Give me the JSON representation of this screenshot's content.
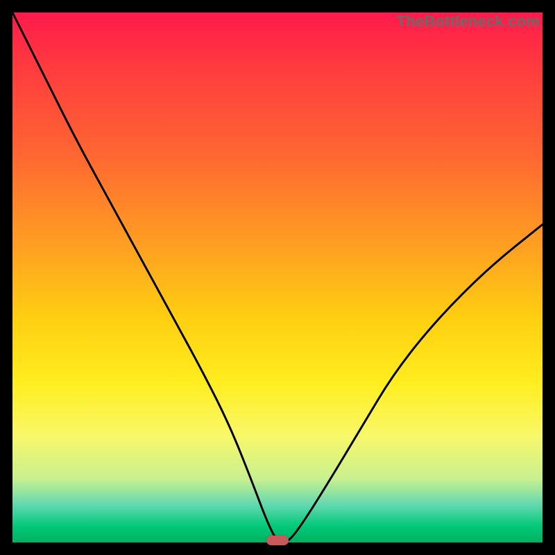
{
  "watermark": "TheBottleneck.com",
  "colors": {
    "frame_bg": "#000000",
    "curve_stroke": "#000000",
    "marker_fill": "#c75a5a",
    "gradient_top": "#ff1a4b",
    "gradient_bottom": "#00b060"
  },
  "chart_data": {
    "type": "line",
    "title": "",
    "xlabel": "",
    "ylabel": "",
    "xlim": [
      0,
      100
    ],
    "ylim": [
      0,
      100
    ],
    "grid": false,
    "legend": false,
    "series": [
      {
        "name": "bottleneck-curve",
        "x": [
          0,
          6,
          12,
          18,
          24,
          30,
          36,
          41,
          45,
          48,
          50,
          52,
          55,
          60,
          66,
          72,
          80,
          90,
          100
        ],
        "y": [
          100,
          88,
          76,
          65,
          54,
          43,
          32,
          22,
          12,
          4,
          0,
          0,
          4,
          12,
          22,
          32,
          42,
          52,
          60
        ]
      }
    ],
    "marker": {
      "x": 50,
      "y": 0
    },
    "background": "vertical-gradient red→green"
  }
}
